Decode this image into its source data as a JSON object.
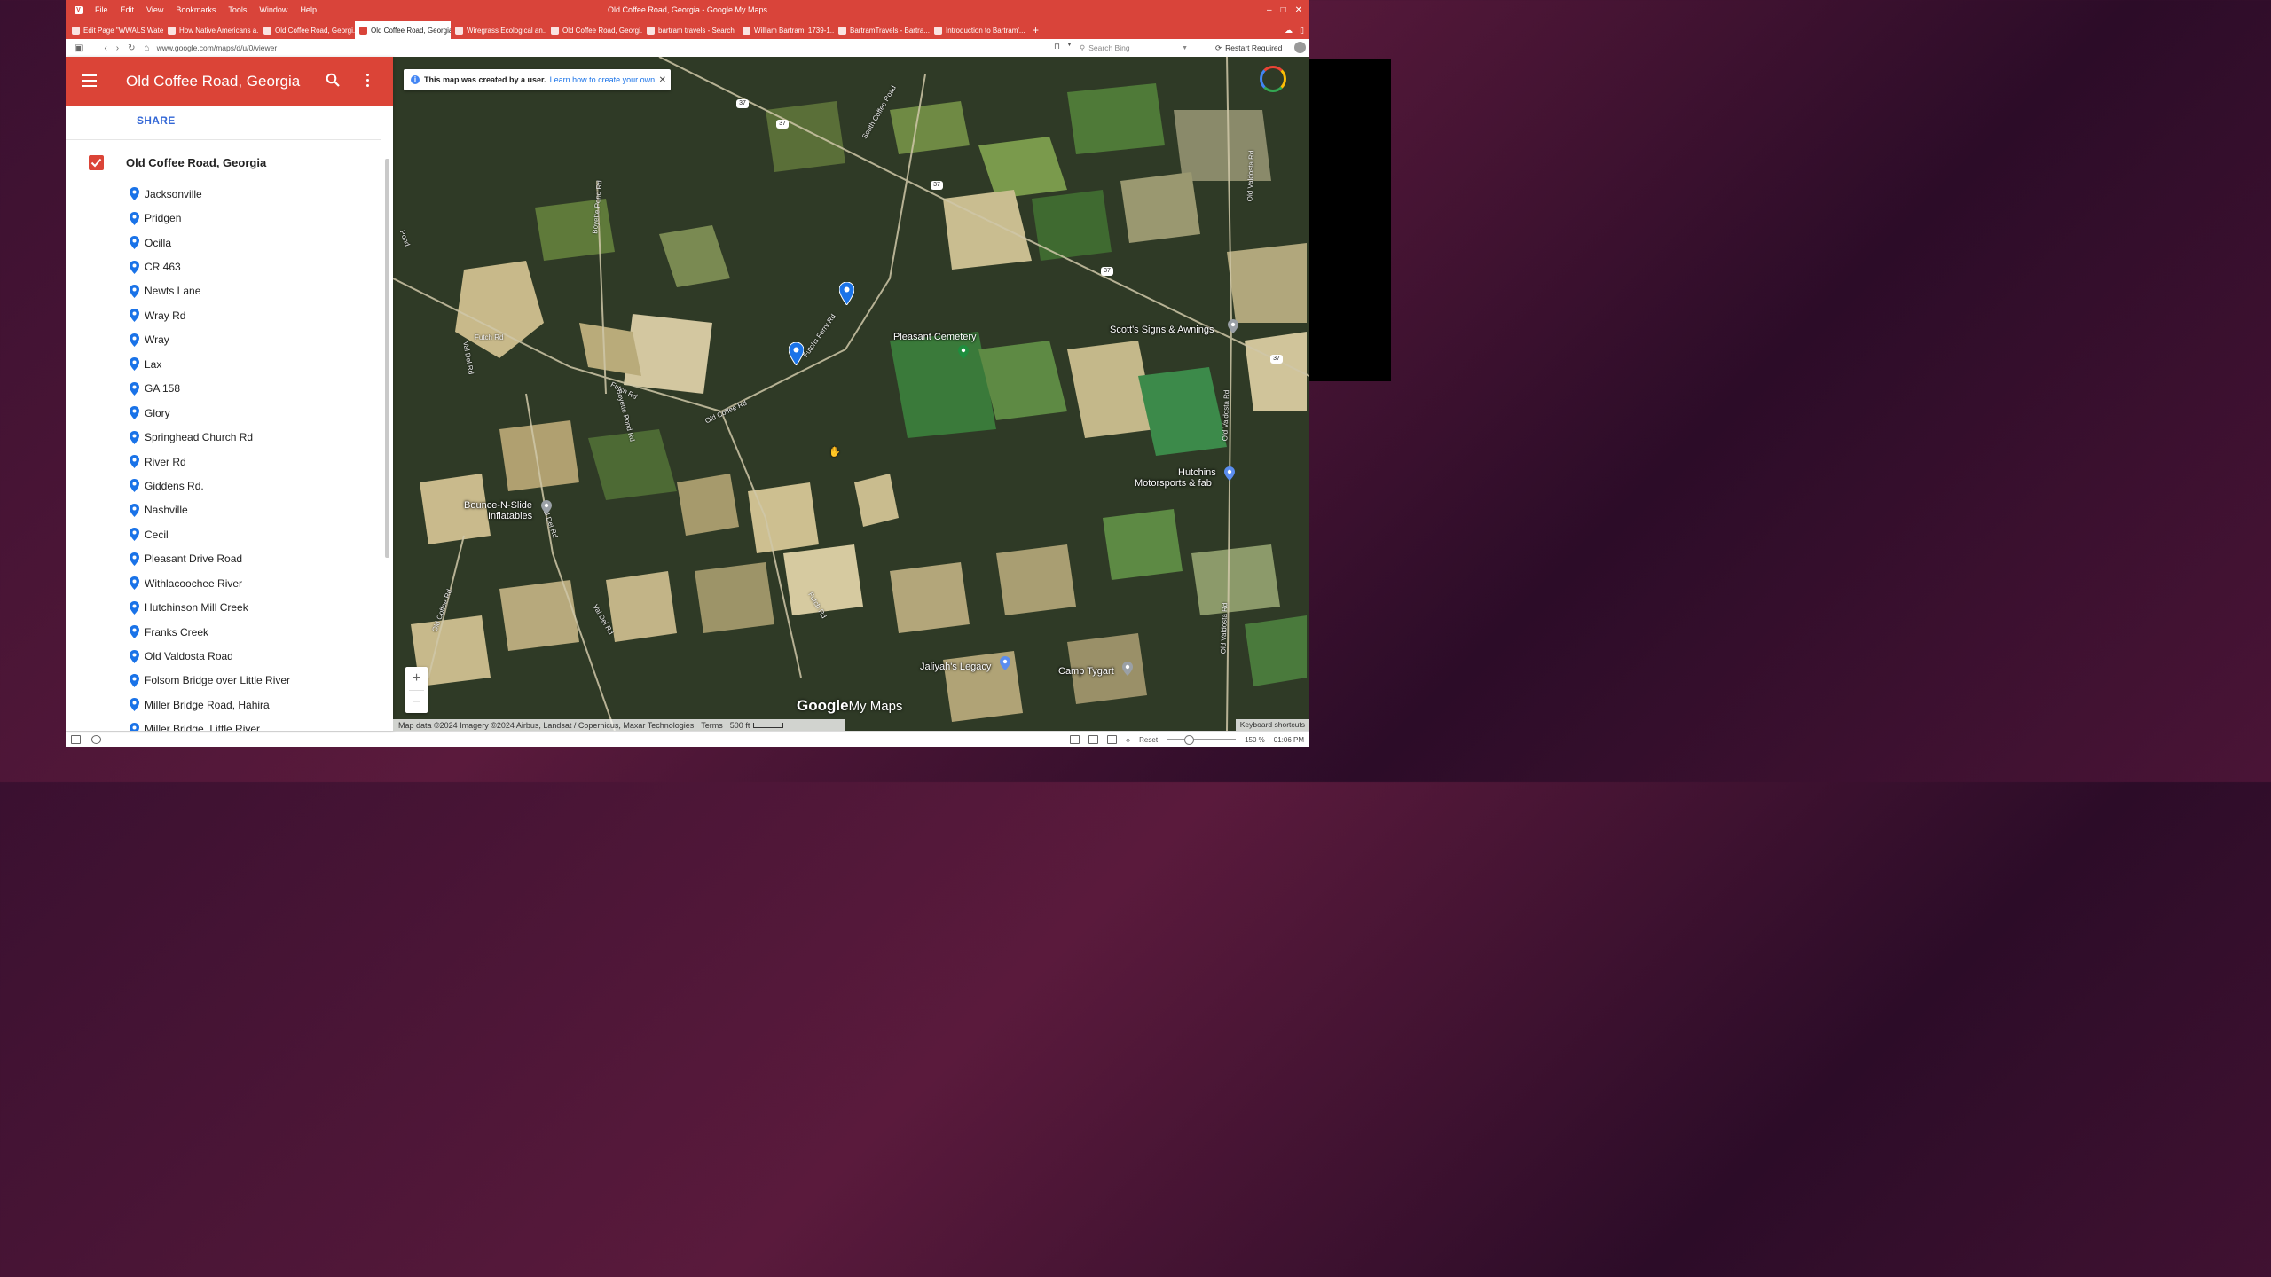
{
  "browser": {
    "menu": [
      "File",
      "Edit",
      "View",
      "Bookmarks",
      "Tools",
      "Window",
      "Help"
    ],
    "window_title": "Old Coffee Road, Georgia - Google My Maps",
    "tabs": [
      {
        "label": "Edit Page \"WWALS Wate...",
        "active": false
      },
      {
        "label": "How Native Americans a...",
        "active": false
      },
      {
        "label": "Old Coffee Road, Georgi...",
        "active": false
      },
      {
        "label": "Old Coffee Road, Georgia -",
        "active": true
      },
      {
        "label": "Wiregrass Ecological an...",
        "active": false
      },
      {
        "label": "Old Coffee Road, Georgi...",
        "active": false
      },
      {
        "label": "bartram travels - Search",
        "active": false
      },
      {
        "label": "William Bartram, 1739-1...",
        "active": false
      },
      {
        "label": "BartramTravels - Bartra...",
        "active": false
      },
      {
        "label": "Introduction to Bartram'...",
        "active": false
      }
    ],
    "new_tab": "+",
    "url": "www.google.com/maps/d/u/0/viewer",
    "search_placeholder": "Search Bing",
    "restart_label": "Restart Required",
    "status": {
      "reset": "Reset",
      "zoom": "150 %",
      "time": "01:06 PM"
    }
  },
  "sidebar": {
    "title": "Old Coffee Road, Georgia",
    "share": "SHARE",
    "layer_title": "Old Coffee Road, Georgia",
    "places": [
      "Jacksonville",
      "Pridgen",
      "Ocilla",
      "CR 463",
      "Newts Lane",
      "Wray Rd",
      "Wray",
      "Lax",
      "GA 158",
      "Glory",
      "Springhead Church Rd",
      "River Rd",
      "Giddens Rd.",
      "Nashville",
      "Cecil",
      "Pleasant Drive Road",
      "Withlacoochee River",
      "Hutchinson Mill Creek",
      "Franks Creek",
      "Old Valdosta Road",
      "Folsom Bridge over Little River",
      "Miller Bridge Road, Hahira",
      "Miller Bridge, Little River"
    ]
  },
  "map": {
    "banner_text": "This map was created by a user.",
    "banner_link": "Learn how to create your own.",
    "labels": {
      "pleasant_cemetery": "Pleasant Cemetery",
      "scotts_signs": "Scott's Signs & Awnings",
      "hutchins_1": "Hutchins",
      "hutchins_2": "Motorsports & fab",
      "bounce_1": "Bounce-N-Slide",
      "bounce_2": "Inflatables",
      "jaliyahs": "Jaliyah's Legacy",
      "camp_tygart": "Camp Tygart"
    },
    "roads": {
      "futch_rd_1": "Futch Rd",
      "futch_rd_2": "Futch Rd",
      "futch_rd_3": "Futch Rd",
      "futch_ferry": "Futchs Ferry Rd",
      "old_coffee_1": "Old Coffee Rd",
      "old_coffee_2": "Old Coffee Rd",
      "boyette_1": "Boyette Pond Rd",
      "boyette_2": "Boyette Pond Rd",
      "val_del_1": "Val Del Rd",
      "val_del_2": "Val Del Rd",
      "val_del_3": "Val Del Rd",
      "south_coffee": "South Coffee Road",
      "old_valdosta_1": "Old Valdosta Rd",
      "old_valdosta_2": "Old Valdosta Rd",
      "old_valdosta_3": "Old Valdosta Rd",
      "pond": "Pond"
    },
    "shields": [
      "37",
      "37",
      "37",
      "37",
      "37"
    ],
    "attribution": "Map data ©2024 Imagery ©2024 Airbus, Landsat / Copernicus, Maxar Technologies",
    "terms": "Terms",
    "scale": "500 ft",
    "keyboard": "Keyboard shortcuts",
    "logo_google": "Google",
    "logo_my": "My Maps",
    "zoom_in": "+",
    "zoom_out": "−",
    "colors": {
      "header": "#db4437",
      "pin": "#1a73e8",
      "link": "#3367d6"
    }
  }
}
